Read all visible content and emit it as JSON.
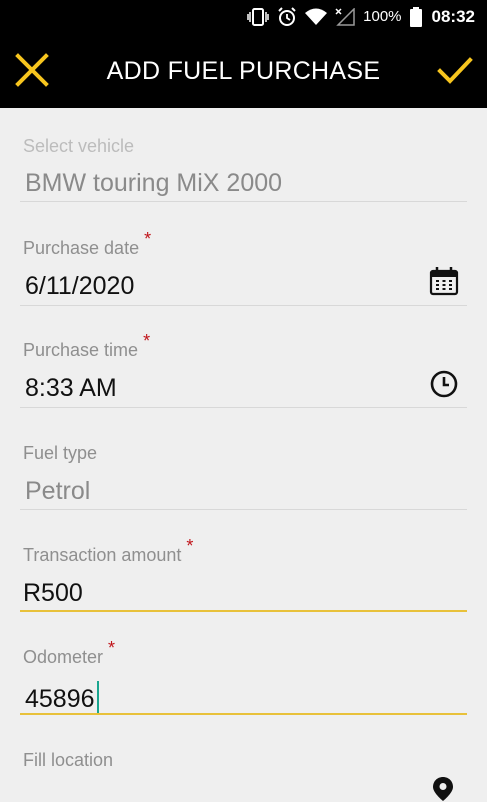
{
  "status_bar": {
    "battery_percent": "100%",
    "time": "08:32",
    "icons": [
      "vibrate-icon",
      "alarm-icon",
      "wifi-icon",
      "signal-icon",
      "battery-icon"
    ]
  },
  "app_bar": {
    "title": "ADD FUEL PURCHASE",
    "close_icon": "close-icon",
    "save_icon": "check-icon"
  },
  "form": {
    "vehicle": {
      "label": "Select vehicle",
      "value": "BMW touring MiX 2000"
    },
    "purchase_date": {
      "label": "Purchase date",
      "required": "*",
      "value": "6/11/2020",
      "icon": "calendar-icon"
    },
    "purchase_time": {
      "label": "Purchase time",
      "required": "*",
      "value": "8:33 AM",
      "icon": "clock-icon"
    },
    "fuel_type": {
      "label": "Fuel type",
      "value": "Petrol"
    },
    "transaction_amount": {
      "label": "Transaction amount",
      "required": "*",
      "value": "R500"
    },
    "odometer": {
      "label": "Odometer",
      "required": "*",
      "value": "45896"
    },
    "fill_location": {
      "label": "Fill location",
      "value": "",
      "icon": "location-pin-icon"
    }
  },
  "colors": {
    "accent": "#f7c51e",
    "required": "#c0141a",
    "cursor": "#1aa58f",
    "background": "#efefef"
  }
}
